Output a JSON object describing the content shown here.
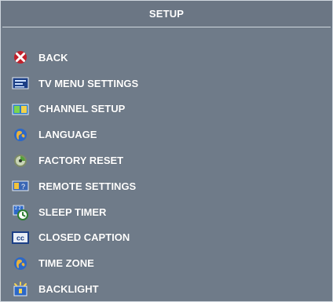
{
  "header": {
    "title": "SETUP"
  },
  "menu": {
    "items": [
      {
        "label": "BACK",
        "icon": "close-icon"
      },
      {
        "label": "TV MENU SETTINGS",
        "icon": "tv-menu-icon"
      },
      {
        "label": "CHANNEL SETUP",
        "icon": "channel-setup-icon"
      },
      {
        "label": "LANGUAGE",
        "icon": "globe-icon"
      },
      {
        "label": "FACTORY RESET",
        "icon": "reset-icon"
      },
      {
        "label": "REMOTE SETTINGS",
        "icon": "remote-icon"
      },
      {
        "label": "SLEEP TIMER",
        "icon": "sleep-timer-icon"
      },
      {
        "label": "CLOSED CAPTION",
        "icon": "cc-icon"
      },
      {
        "label": "TIME ZONE",
        "icon": "globe-icon"
      },
      {
        "label": "BACKLIGHT",
        "icon": "backlight-icon"
      }
    ]
  },
  "colors": {
    "background": "#6f7b89",
    "text": "#ffffff",
    "divider": "#cfd6dd"
  }
}
